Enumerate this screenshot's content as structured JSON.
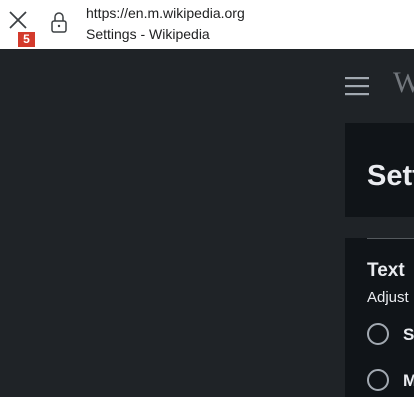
{
  "browser": {
    "url": "https://en.m.wikipedia.org",
    "page_title": "Settings - Wikipedia",
    "tab_count": "5"
  },
  "site": {
    "wordmark": "W",
    "heading": "Settings"
  },
  "text_section": {
    "title": "Text",
    "description": "Adjust",
    "options": [
      {
        "label": "S"
      },
      {
        "label": "M"
      }
    ]
  },
  "colors": {
    "page_bg": "#1f2327",
    "panel_bg": "#101418",
    "badge": "#d33a2c"
  }
}
